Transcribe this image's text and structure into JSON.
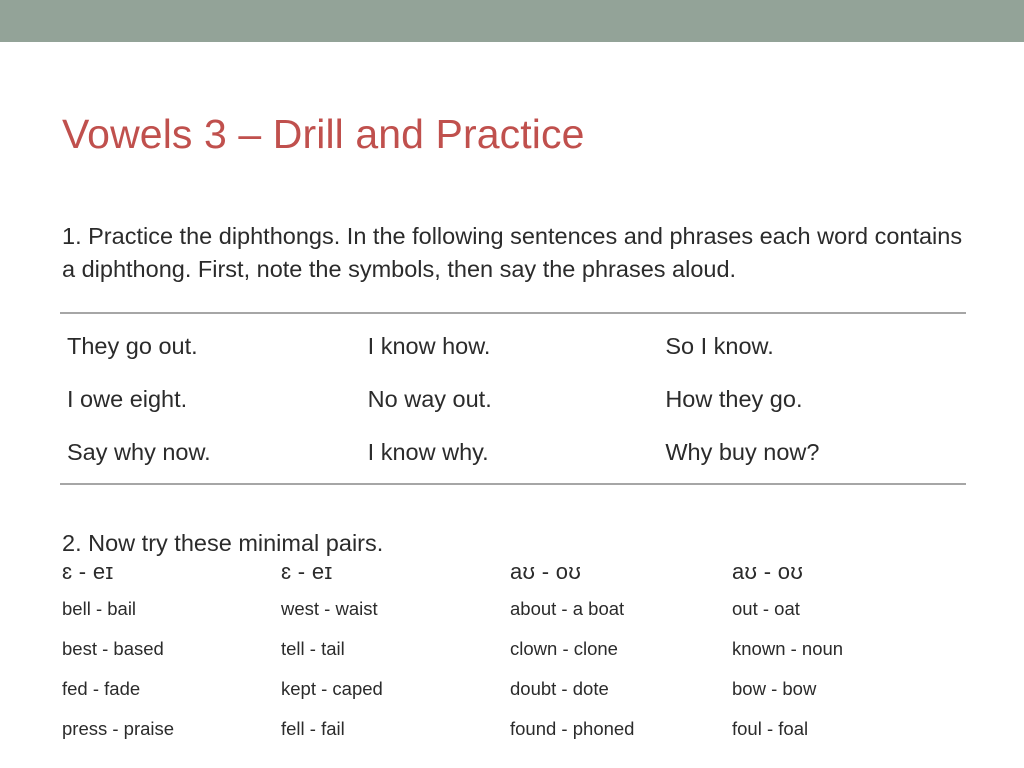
{
  "slide": {
    "title": "Vowels 3 – Drill and Practice",
    "accent_color": "#c0504d",
    "top_bar_color": "#93a398",
    "rule_color": "#a6a6a6",
    "text_color": "#2b2b2b"
  },
  "intro": {
    "paragraph": "1. Practice the diphthongs.  In the following sentences and phrases each word contains a diphthong. First, note the symbols, then say the phrases aloud."
  },
  "phrases_table": {
    "rows": [
      {
        "c1": "They go out.",
        "c2": "I know how.",
        "c3": "So I know."
      },
      {
        "c1": "I owe eight.",
        "c2": "No way out.",
        "c3": "How they go."
      },
      {
        "c1": "Say why now.",
        "c2": "I know why.",
        "c3": "Why buy now?"
      }
    ]
  },
  "pairs_section": {
    "heading": "2. Now try these minimal pairs.",
    "columns": [
      {
        "symbol": "ɛ - eɪ",
        "pairs": [
          "bell - bail",
          "best - based",
          "fed - fade",
          "press - praise"
        ]
      },
      {
        "symbol": "ɛ - eɪ",
        "pairs": [
          "west - waist",
          "tell - tail",
          "kept - caped",
          "fell - fail"
        ]
      },
      {
        "symbol": "aʊ - oʊ",
        "pairs": [
          "about - a boat",
          "clown - clone",
          "doubt - dote",
          "found - phoned"
        ]
      },
      {
        "symbol": "aʊ - oʊ",
        "pairs": [
          "out - oat",
          "known - noun",
          "bow - bow",
          "foul - foal"
        ]
      }
    ]
  }
}
